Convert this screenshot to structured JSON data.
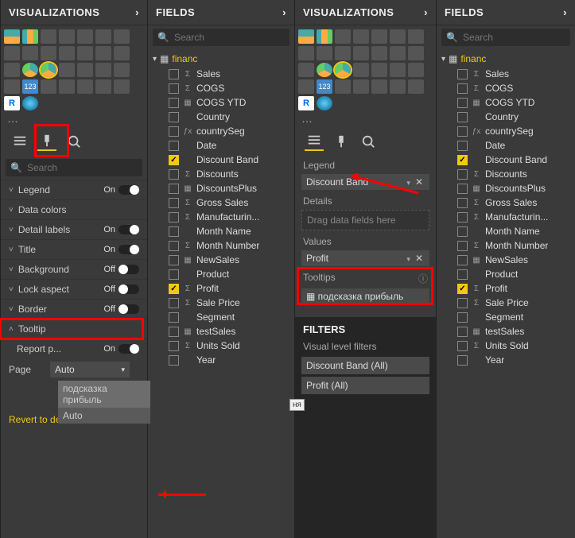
{
  "panels": {
    "visualizations": "VISUALIZATIONS",
    "fields": "FIELDS",
    "filters": "FILTERS"
  },
  "search_placeholder": "Search",
  "format": {
    "items": [
      {
        "label": "Legend",
        "value": "On",
        "state": "on"
      },
      {
        "label": "Data colors",
        "value": "",
        "state": ""
      },
      {
        "label": "Detail labels",
        "value": "On",
        "state": "on"
      },
      {
        "label": "Title",
        "value": "On",
        "state": "on"
      },
      {
        "label": "Background",
        "value": "Off",
        "state": "off"
      },
      {
        "label": "Lock aspect",
        "value": "Off",
        "state": "off"
      },
      {
        "label": "Border",
        "value": "Off",
        "state": "off"
      },
      {
        "label": "Tooltip",
        "value": "",
        "state": ""
      }
    ],
    "report_page": {
      "label": "Report p...",
      "value": "On"
    },
    "page_label": "Page",
    "page_value": "Auto",
    "dropdown_options": [
      "подсказка прибыль",
      "Auto"
    ],
    "revert": "Revert to def"
  },
  "wells": {
    "legend": {
      "label": "Legend",
      "value": "Discount Band"
    },
    "details": {
      "label": "Details",
      "placeholder": "Drag data fields here"
    },
    "values": {
      "label": "Values",
      "value": "Profit"
    },
    "tooltips": {
      "label": "Tooltips",
      "value": "подсказка прибыль"
    }
  },
  "filters": {
    "sub": "Visual level filters",
    "items": [
      "Discount Band  (All)",
      "Profit  (All)"
    ]
  },
  "table_name": "financ",
  "fields": [
    {
      "name": "Sales",
      "type": "Σ",
      "checked": false
    },
    {
      "name": "COGS",
      "type": "Σ",
      "checked": false
    },
    {
      "name": "COGS YTD",
      "type": "▦",
      "checked": false
    },
    {
      "name": "Country",
      "type": "",
      "checked": false
    },
    {
      "name": "countrySeg",
      "type": "ƒx",
      "checked": false
    },
    {
      "name": "Date",
      "type": "",
      "checked": false
    },
    {
      "name": "Discount Band",
      "type": "",
      "checked": true
    },
    {
      "name": "Discounts",
      "type": "Σ",
      "checked": false
    },
    {
      "name": "DiscountsPlus",
      "type": "▦",
      "checked": false
    },
    {
      "name": "Gross Sales",
      "type": "Σ",
      "checked": false
    },
    {
      "name": "Manufacturin...",
      "type": "Σ",
      "checked": false
    },
    {
      "name": "Month Name",
      "type": "",
      "checked": false
    },
    {
      "name": "Month Number",
      "type": "Σ",
      "checked": false
    },
    {
      "name": "NewSales",
      "type": "▦",
      "checked": false
    },
    {
      "name": "Product",
      "type": "",
      "checked": false
    },
    {
      "name": "Profit",
      "type": "Σ",
      "checked": true
    },
    {
      "name": "Sale Price",
      "type": "Σ",
      "checked": false
    },
    {
      "name": "Segment",
      "type": "",
      "checked": false
    },
    {
      "name": "testSales",
      "type": "▦",
      "checked": false
    },
    {
      "name": "Units Sold",
      "type": "Σ",
      "checked": false
    },
    {
      "name": "Year",
      "type": "",
      "checked": false
    }
  ],
  "tag": "ня"
}
